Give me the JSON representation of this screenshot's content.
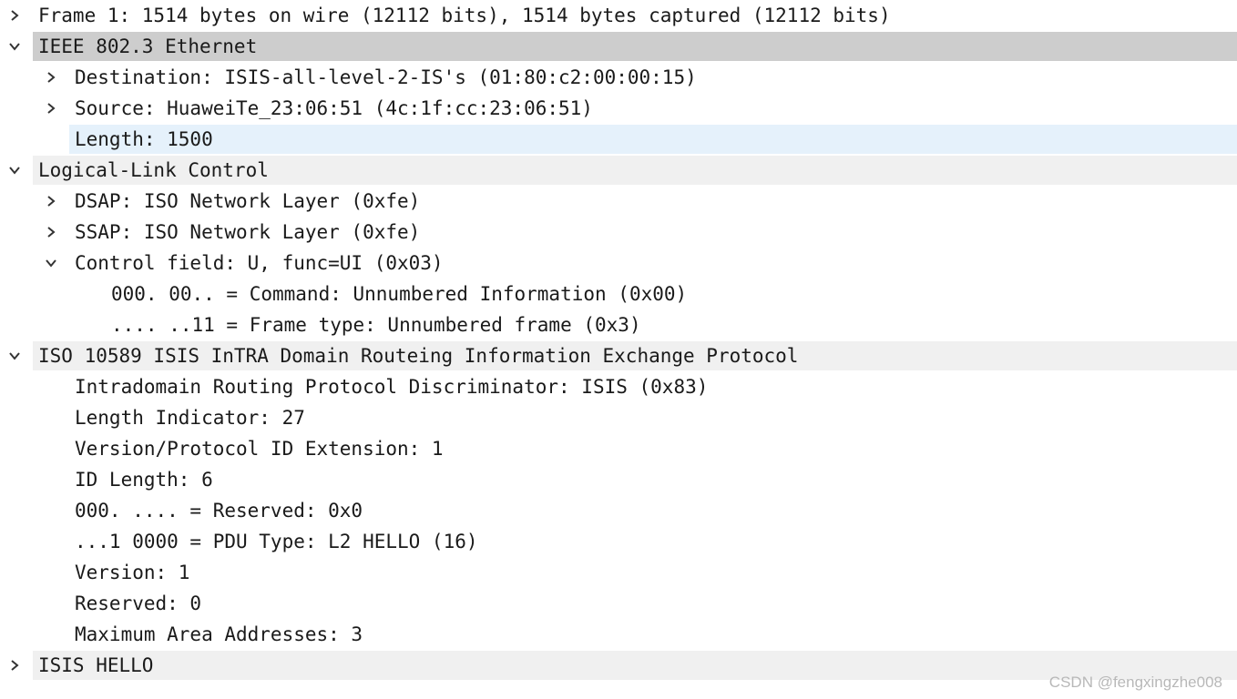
{
  "rows": [
    {
      "text": "Frame 1: 1514 bytes on wire (12112 bits), 1514 bytes captured (12112 bits)",
      "depth": 0,
      "state": "collapsed",
      "style": "plain"
    },
    {
      "text": "IEEE 802.3 Ethernet",
      "depth": 0,
      "state": "expanded",
      "style": "section-selected"
    },
    {
      "text": "Destination: ISIS-all-level-2-IS's (01:80:c2:00:00:15)",
      "depth": 1,
      "state": "collapsed",
      "style": "plain"
    },
    {
      "text": "Source: HuaweiTe_23:06:51 (4c:1f:cc:23:06:51)",
      "depth": 1,
      "state": "collapsed",
      "style": "plain"
    },
    {
      "text": "Length: 1500",
      "depth": 1,
      "state": "leaf",
      "style": "selected"
    },
    {
      "text": "Logical-Link Control",
      "depth": 0,
      "state": "expanded",
      "style": "section"
    },
    {
      "text": "DSAP: ISO Network Layer (0xfe)",
      "depth": 1,
      "state": "collapsed",
      "style": "plain"
    },
    {
      "text": "SSAP: ISO Network Layer (0xfe)",
      "depth": 1,
      "state": "collapsed",
      "style": "plain"
    },
    {
      "text": "Control field: U, func=UI (0x03)",
      "depth": 1,
      "state": "expanded",
      "style": "plain"
    },
    {
      "text": "000. 00.. = Command: Unnumbered Information (0x00)",
      "depth": 2,
      "state": "leaf",
      "style": "plain"
    },
    {
      "text": ".... ..11 = Frame type: Unnumbered frame (0x3)",
      "depth": 2,
      "state": "leaf",
      "style": "plain"
    },
    {
      "text": "ISO 10589 ISIS InTRA Domain Routeing Information Exchange Protocol",
      "depth": 0,
      "state": "expanded",
      "style": "section"
    },
    {
      "text": "Intradomain Routing Protocol Discriminator: ISIS (0x83)",
      "depth": 1,
      "state": "leaf",
      "style": "plain"
    },
    {
      "text": "Length Indicator: 27",
      "depth": 1,
      "state": "leaf",
      "style": "plain"
    },
    {
      "text": "Version/Protocol ID Extension: 1",
      "depth": 1,
      "state": "leaf",
      "style": "plain"
    },
    {
      "text": "ID Length: 6",
      "depth": 1,
      "state": "leaf",
      "style": "plain"
    },
    {
      "text": "000. .... = Reserved: 0x0",
      "depth": 1,
      "state": "leaf",
      "style": "plain"
    },
    {
      "text": "...1 0000 = PDU Type: L2 HELLO (16)",
      "depth": 1,
      "state": "leaf",
      "style": "plain"
    },
    {
      "text": "Version: 1",
      "depth": 1,
      "state": "leaf",
      "style": "plain"
    },
    {
      "text": "Reserved: 0",
      "depth": 1,
      "state": "leaf",
      "style": "plain"
    },
    {
      "text": "Maximum Area Addresses: 3",
      "depth": 1,
      "state": "leaf",
      "style": "plain"
    },
    {
      "text": "ISIS HELLO",
      "depth": 0,
      "state": "collapsed",
      "style": "section"
    }
  ],
  "icons": {
    "collapsed": "chevron-right-icon",
    "expanded": "chevron-down-icon"
  },
  "colors": {
    "section_bg": "#f0f0f0",
    "section_selected_bg": "#cdcdcd",
    "selected_bg": "#e5f1fb",
    "text": "#1a1a1a"
  },
  "watermark": "CSDN @fengxingzhe008"
}
